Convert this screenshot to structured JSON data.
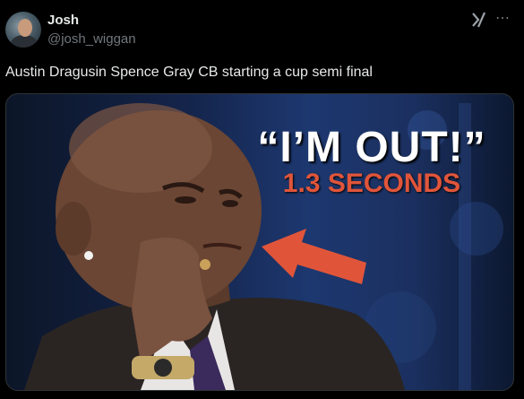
{
  "author": {
    "display_name": "Josh",
    "handle": "@josh_wiggan"
  },
  "tweet": {
    "text": "Austin Dragusin Spence Gray CB starting a cup semi final"
  },
  "media": {
    "meme_main": "“I’M OUT!”",
    "meme_sub": "1.3 SECONDS"
  },
  "icons": {
    "grok": "grok-icon",
    "more": "more-horizontal-icon",
    "arrow": "arrow-left-icon"
  },
  "colors": {
    "background": "#000000",
    "text": "#e7e9ea",
    "muted": "#71767b",
    "arrow": "#e0553a"
  }
}
